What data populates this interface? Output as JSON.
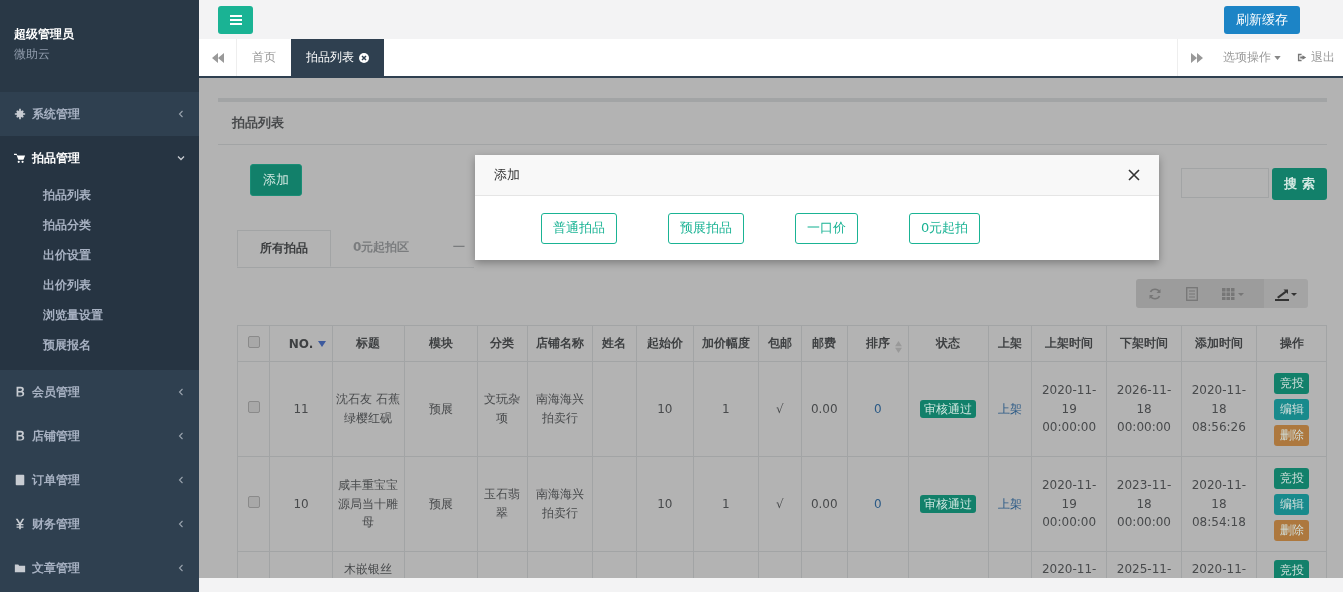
{
  "sidebar": {
    "user": {
      "name": "超级管理员",
      "org": "微助云"
    },
    "items": [
      {
        "label": "系统管理",
        "expanded": false
      },
      {
        "label": "拍品管理",
        "expanded": true,
        "children": [
          {
            "label": "拍品列表"
          },
          {
            "label": "拍品分类"
          },
          {
            "label": "出价设置"
          },
          {
            "label": "出价列表"
          },
          {
            "label": "浏览量设置"
          },
          {
            "label": "预展报名"
          }
        ]
      },
      {
        "label": "会员管理",
        "expanded": false
      },
      {
        "label": "店铺管理",
        "expanded": false
      },
      {
        "label": "订单管理",
        "expanded": false
      },
      {
        "label": "财务管理",
        "expanded": false
      },
      {
        "label": "文章管理",
        "expanded": false
      }
    ]
  },
  "topbar": {
    "refresh_button": "刷新缓存"
  },
  "page_tabs": [
    {
      "label": "首页",
      "selected": false
    },
    {
      "label": "拍品列表",
      "selected": true
    }
  ],
  "tab_actions": {
    "options": "选项操作",
    "logout": "退出"
  },
  "panel": {
    "title": "拍品列表",
    "add_button": "添加",
    "search_button": "搜 索",
    "tabs": [
      {
        "label": "所有拍品",
        "selected": true
      },
      {
        "label": "0元起拍区",
        "selected": false
      },
      {
        "label": "一",
        "selected": false
      }
    ]
  },
  "table": {
    "select_all_checked": false,
    "columns": [
      {
        "label": "NO.",
        "sortable": true,
        "sorted": true
      },
      {
        "label": "标题",
        "sortable": false
      },
      {
        "label": "模块",
        "sortable": false
      },
      {
        "label": "分类",
        "sortable": false
      },
      {
        "label": "店铺名称",
        "sortable": false
      },
      {
        "label": "姓名",
        "sortable": false
      },
      {
        "label": "起始价",
        "sortable": false
      },
      {
        "label": "加价幅度",
        "sortable": false
      },
      {
        "label": "包邮",
        "sortable": false
      },
      {
        "label": "邮费",
        "sortable": false
      },
      {
        "label": "排序",
        "sortable": true,
        "sorted": false
      },
      {
        "label": "状态",
        "sortable": false
      },
      {
        "label": "上架",
        "sortable": false
      },
      {
        "label": "上架时间",
        "sortable": false
      },
      {
        "label": "下架时间",
        "sortable": false
      },
      {
        "label": "添加时间",
        "sortable": false
      },
      {
        "label": "操作",
        "sortable": false
      }
    ],
    "rows": [
      {
        "checked": false,
        "no": "11",
        "title": "沈石友 石蕉绿樱红砚",
        "module": "预展",
        "category": "文玩杂项",
        "shop": "南海海兴拍卖行",
        "start_price": "10",
        "increment": "1",
        "free_shipping": "√",
        "postage": "0.00",
        "sort": "0",
        "status": "审核通过",
        "shelf": "上架",
        "on_time": "2020-11-19 00:00:00",
        "off_time": "2026-11-18 00:00:00",
        "added_time": "2020-11-18 08:56:26",
        "actions": [
          {
            "label": "竞投",
            "kind": "bid"
          },
          {
            "label": "编辑",
            "kind": "edit"
          },
          {
            "label": "删除",
            "kind": "delete"
          }
        ]
      },
      {
        "checked": false,
        "no": "10",
        "title": "咸丰重宝宝源局当十雕母",
        "module": "预展",
        "category": "玉石翡翠",
        "shop": "南海海兴拍卖行",
        "start_price": "10",
        "increment": "1",
        "free_shipping": "√",
        "postage": "0.00",
        "sort": "0",
        "status": "审核通过",
        "shelf": "上架",
        "on_time": "2020-11-19 00:00:00",
        "off_time": "2023-11-18 00:00:00",
        "added_time": "2020-11-18 08:54:18",
        "actions": [
          {
            "label": "竞投",
            "kind": "bid"
          },
          {
            "label": "编辑",
            "kind": "edit"
          },
          {
            "label": "删除",
            "kind": "delete"
          }
        ]
      },
      {
        "title": "木嵌银丝",
        "on_time": "2020-11-",
        "off_time": "2025-11-",
        "added_time": "2020-11-",
        "actions": [
          {
            "label": "竞投",
            "kind": "bid"
          }
        ]
      }
    ]
  },
  "modal": {
    "title": "添加",
    "buttons": [
      "普通拍品",
      "预展拍品",
      "一口价",
      "0元起拍"
    ]
  }
}
